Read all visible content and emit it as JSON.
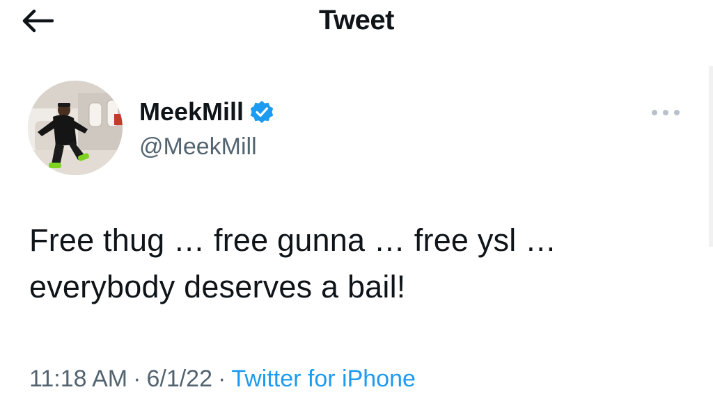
{
  "header": {
    "title": "Tweet",
    "back_icon": "arrow-left-icon"
  },
  "tweet": {
    "author": {
      "display_name": "MeekMill",
      "handle": "@MeekMill",
      "verified": true,
      "verified_icon": "verified-badge-icon"
    },
    "more_icon": "more-horizontal-icon",
    "text_line_1": "Free thug … free gunna … free ysl …",
    "text_line_2": "everybody deserves a bail!",
    "time": "11:18 AM",
    "separator": "·",
    "date": "6/1/22",
    "source": "Twitter for iPhone"
  },
  "colors": {
    "text_primary": "#0f1419",
    "text_secondary": "#536471",
    "accent": "#1d9bf0"
  }
}
